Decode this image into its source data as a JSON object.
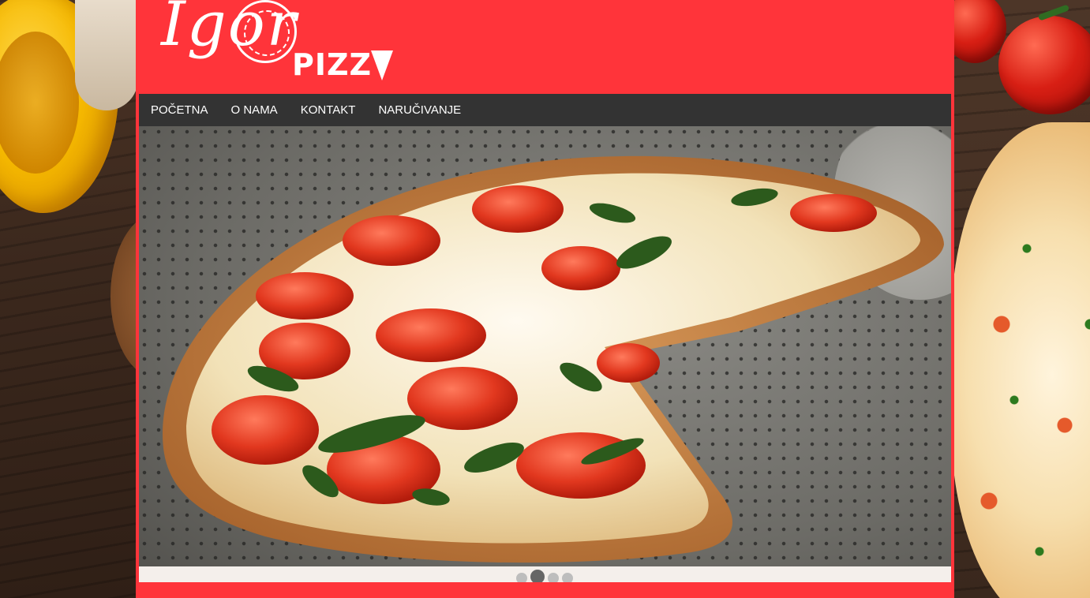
{
  "brand": {
    "logo_script": "Igor",
    "logo_suffix": "PIZZ",
    "accent_color": "#ff343a",
    "nav_background": "#333333"
  },
  "nav": {
    "items": [
      {
        "label": "POČETNA"
      },
      {
        "label": "O NAMA"
      },
      {
        "label": "KONTAKT"
      },
      {
        "label": "NARUČIVANJE"
      }
    ]
  },
  "slider": {
    "slide_count": 4,
    "active_index": 1,
    "image": "pizza-image"
  },
  "icons": [
    "pizza-slice-icon",
    "pizza-circle-icon"
  ]
}
